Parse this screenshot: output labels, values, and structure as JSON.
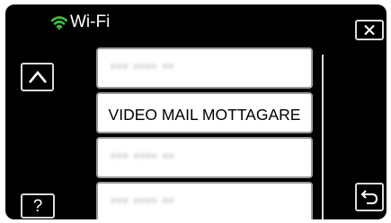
{
  "header": {
    "title": "Wi-Fi",
    "wifi_icon": "wifi-icon",
    "close_icon": "close-x-icon"
  },
  "navigation": {
    "up_icon": "chevron-up-icon",
    "help_label": "?",
    "back_icon": "return-arrow-icon"
  },
  "list": {
    "items": [
      {
        "label": "",
        "state": "blurred"
      },
      {
        "label": "VIDEO MAIL MOTTAGARE",
        "state": "normal"
      },
      {
        "label": "",
        "state": "blurred"
      },
      {
        "label": "",
        "state": "blurred"
      }
    ]
  },
  "colors": {
    "background": "#000000",
    "accent_wifi": "#3fbf3f",
    "item_background": "#ffffff",
    "button_border": "#dcdcdc"
  }
}
